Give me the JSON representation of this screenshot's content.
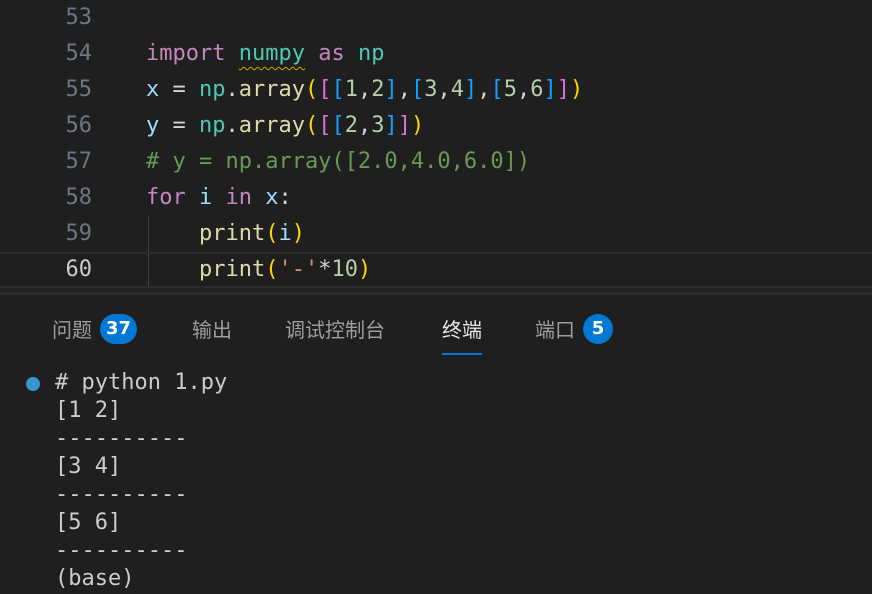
{
  "editor": {
    "lines": [
      {
        "number": "53",
        "segments": []
      },
      {
        "number": "54",
        "segments": [
          {
            "t": "import",
            "c": "kw"
          },
          {
            "t": " ",
            "c": "op"
          },
          {
            "t": "numpy",
            "c": "mod squiggle"
          },
          {
            "t": " ",
            "c": "op"
          },
          {
            "t": "as",
            "c": "kw"
          },
          {
            "t": " ",
            "c": "op"
          },
          {
            "t": "np",
            "c": "mod"
          }
        ]
      },
      {
        "number": "55",
        "segments": [
          {
            "t": "x",
            "c": "var"
          },
          {
            "t": " = ",
            "c": "op"
          },
          {
            "t": "np",
            "c": "mod"
          },
          {
            "t": ".",
            "c": "op"
          },
          {
            "t": "array",
            "c": "fn"
          },
          {
            "t": "(",
            "c": "b1"
          },
          {
            "t": "[",
            "c": "b2"
          },
          {
            "t": "[",
            "c": "b3"
          },
          {
            "t": "1",
            "c": "num"
          },
          {
            "t": ",",
            "c": "op"
          },
          {
            "t": "2",
            "c": "num"
          },
          {
            "t": "]",
            "c": "b3"
          },
          {
            "t": ",",
            "c": "op"
          },
          {
            "t": "[",
            "c": "b3"
          },
          {
            "t": "3",
            "c": "num"
          },
          {
            "t": ",",
            "c": "op"
          },
          {
            "t": "4",
            "c": "num"
          },
          {
            "t": "]",
            "c": "b3"
          },
          {
            "t": ",",
            "c": "op"
          },
          {
            "t": "[",
            "c": "b3"
          },
          {
            "t": "5",
            "c": "num"
          },
          {
            "t": ",",
            "c": "op"
          },
          {
            "t": "6",
            "c": "num"
          },
          {
            "t": "]",
            "c": "b3"
          },
          {
            "t": "]",
            "c": "b2"
          },
          {
            "t": ")",
            "c": "b1"
          }
        ]
      },
      {
        "number": "56",
        "segments": [
          {
            "t": "y",
            "c": "var"
          },
          {
            "t": " = ",
            "c": "op"
          },
          {
            "t": "np",
            "c": "mod"
          },
          {
            "t": ".",
            "c": "op"
          },
          {
            "t": "array",
            "c": "fn"
          },
          {
            "t": "(",
            "c": "b1"
          },
          {
            "t": "[",
            "c": "b2"
          },
          {
            "t": "[",
            "c": "b3"
          },
          {
            "t": "2",
            "c": "num"
          },
          {
            "t": ",",
            "c": "op"
          },
          {
            "t": "3",
            "c": "num"
          },
          {
            "t": "]",
            "c": "b3"
          },
          {
            "t": "]",
            "c": "b2"
          },
          {
            "t": ")",
            "c": "b1"
          }
        ]
      },
      {
        "number": "57",
        "segments": [
          {
            "t": "# y = np.array([2.0,4.0,6.0])",
            "c": "cmt"
          }
        ]
      },
      {
        "number": "58",
        "segments": [
          {
            "t": "for",
            "c": "kw"
          },
          {
            "t": " ",
            "c": "op"
          },
          {
            "t": "i",
            "c": "var"
          },
          {
            "t": " ",
            "c": "op"
          },
          {
            "t": "in",
            "c": "kw"
          },
          {
            "t": " ",
            "c": "op"
          },
          {
            "t": "x",
            "c": "var"
          },
          {
            "t": ":",
            "c": "op"
          }
        ]
      },
      {
        "number": "59",
        "segments": [
          {
            "t": "    ",
            "c": "op"
          },
          {
            "t": "print",
            "c": "fn"
          },
          {
            "t": "(",
            "c": "b1"
          },
          {
            "t": "i",
            "c": "var"
          },
          {
            "t": ")",
            "c": "b1"
          }
        ]
      },
      {
        "number": "60",
        "active": true,
        "segments": [
          {
            "t": "    ",
            "c": "op"
          },
          {
            "t": "print",
            "c": "fn"
          },
          {
            "t": "(",
            "c": "b1"
          },
          {
            "t": "'-'",
            "c": "str"
          },
          {
            "t": "*",
            "c": "op"
          },
          {
            "t": "10",
            "c": "num"
          },
          {
            "t": ")",
            "c": "b1"
          }
        ]
      }
    ]
  },
  "panel": {
    "tabs": [
      {
        "label": "问题",
        "badge": "37",
        "active": false
      },
      {
        "label": "输出",
        "active": false
      },
      {
        "label": "调试控制台",
        "active": false
      },
      {
        "label": "终端",
        "active": true
      },
      {
        "label": "端口",
        "badge": "5",
        "active": false
      }
    ]
  },
  "terminal": {
    "lines": [
      "# python 1.py",
      "[1 2]",
      "----------",
      "[3 4]",
      "----------",
      "[5 6]",
      "----------",
      "(base)"
    ]
  },
  "colors": {
    "accent": "#0078d4",
    "background": "#1f1f1f",
    "terminal_dot": "#3794cc"
  }
}
